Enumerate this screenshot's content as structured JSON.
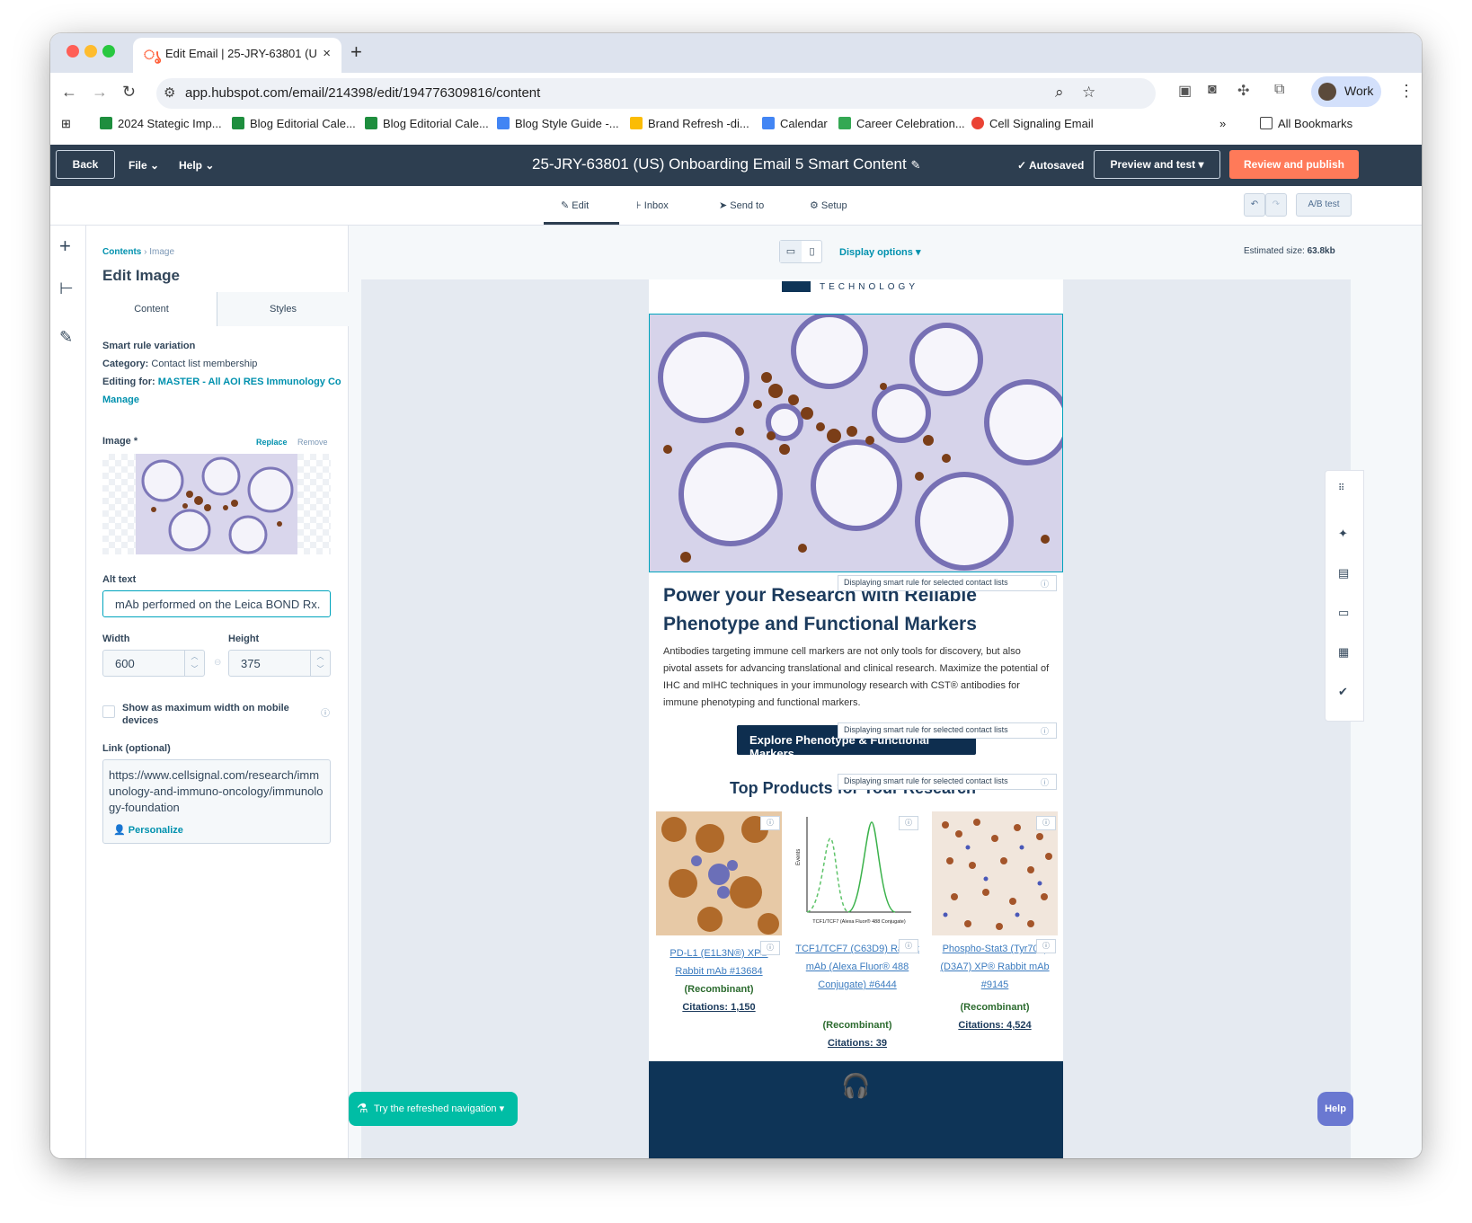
{
  "browser": {
    "tab_title": "Edit Email | 25-JRY-63801 (U",
    "url": "app.hubspot.com/email/214398/edit/194776309816/content",
    "profile_label": "Work",
    "bookmarks": [
      {
        "label": "2024 Stategic Imp...",
        "color": "#1e8e3e"
      },
      {
        "label": "Blog Editorial Cale...",
        "color": "#1e8e3e"
      },
      {
        "label": "Blog Editorial Cale...",
        "color": "#1e8e3e"
      },
      {
        "label": "Blog Style Guide -...",
        "color": "#4285f4"
      },
      {
        "label": "Brand Refresh -di...",
        "color": "#fbbc04"
      },
      {
        "label": "Calendar",
        "color": "#4285f4"
      },
      {
        "label": "Career Celebration...",
        "color": "#34a853"
      },
      {
        "label": "Cell Signaling Email",
        "color": "#ea4335"
      }
    ],
    "all_bookmarks": "All Bookmarks"
  },
  "header": {
    "back": "Back",
    "file": "File",
    "help": "Help",
    "title": "25-JRY-63801 (US) Onboarding Email 5 Smart Content",
    "autosaved": "Autosaved",
    "preview": "Preview and test",
    "publish": "Review and publish"
  },
  "subtabs": {
    "edit": "Edit",
    "inbox": "Inbox",
    "send_to": "Send to",
    "setup": "Setup",
    "ab_test": "A/B test"
  },
  "panel": {
    "breadcrumb_root": "Contents",
    "breadcrumb_leaf": "Image",
    "title": "Edit Image",
    "tab_content": "Content",
    "tab_styles": "Styles",
    "smart_rule_heading": "Smart rule variation",
    "category_label": "Category:",
    "category_value": "Contact list membership",
    "editing_for_label": "Editing for:",
    "editing_for_value": "MASTER - All AOI RES Immunology Co",
    "manage": "Manage",
    "image_label": "Image *",
    "replace": "Replace",
    "remove": "Remove",
    "alt_label": "Alt text",
    "alt_value": "mAb performed on the Leica BOND Rx.",
    "width_label": "Width",
    "width_value": "600",
    "height_label": "Height",
    "height_value": "375",
    "mobile_label": "Show as maximum width on mobile devices",
    "link_label": "Link (optional)",
    "link_value": "https://www.cellsignal.com/research/immunology-and-immuno-oncology/immunology-foundation",
    "personalize": "Personalize"
  },
  "canvas": {
    "display_options": "Display options",
    "estimated_size_label": "Estimated size:",
    "estimated_size_value": "63.8kb",
    "logo_text": "TECHNOLOGY",
    "headline": "Power your Research with Reliable Phenotype and Functional Markers",
    "body": "Antibodies targeting immune cell markers are not only tools for discovery, but also pivotal assets for advancing translational and clinical research. Maximize the potential of IHC and mIHC techniques in your immunology research with CST® antibodies for immune phenotyping and functional markers.",
    "cta": "Explore Phenotype & Functional Markers",
    "smart_badge": "Displaying smart rule for selected contact lists",
    "products_heading": "Top Products for Your Research",
    "products": [
      {
        "name": "PD-L1 (E1L3N®) XP® Rabbit mAb #13684",
        "recombinant": "(Recombinant)",
        "citations": "Citations: 1,150"
      },
      {
        "name": "TCF1/TCF7 (C63D9) Rabbit mAb (Alexa Fluor® 488 Conjugate) #6444",
        "recombinant": "(Recombinant)",
        "citations": "Citations: 39"
      },
      {
        "name": "Phospho-Stat3 (Tyr705) (D3A7) XP® Rabbit mAb #9145",
        "recombinant": "(Recombinant)",
        "citations": "Citations: 4,524"
      }
    ],
    "flow_xlabel": "TCF1/TCF7 (Alexa Fluor® 488 Conjugate)",
    "flow_ylabel": "Events",
    "try_nav": "Try the refreshed navigation",
    "help": "Help"
  }
}
